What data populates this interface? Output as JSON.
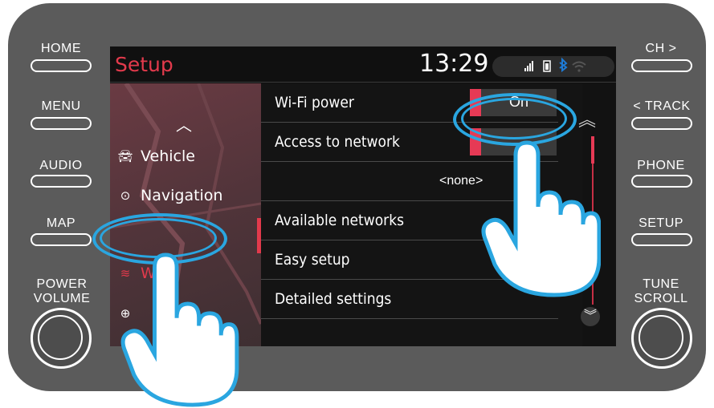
{
  "hardware": {
    "left_buttons": [
      "HOME",
      "MENU",
      "AUDIO",
      "MAP"
    ],
    "right_buttons": [
      "CH >",
      "< TRACK",
      "PHONE",
      "SETUP"
    ],
    "left_knob_label": [
      "POWER",
      "VOLUME"
    ],
    "right_knob_label": [
      "TUNE",
      "SCROLL"
    ]
  },
  "header": {
    "title": "Setup",
    "time": "13:29"
  },
  "sidebar": {
    "items": [
      {
        "label": "Vehicle",
        "icon": "car-icon"
      },
      {
        "label": "Navigation",
        "icon": "navigation-icon"
      },
      {
        "label": "Wi-Fi",
        "icon": "wifi-icon",
        "active": true
      },
      {
        "label": "ne",
        "icon": "globe-icon"
      }
    ]
  },
  "settings": {
    "rows": [
      {
        "label": "Wi-Fi power",
        "toggle": "On"
      },
      {
        "label": "Access to network",
        "toggle": ""
      },
      {
        "label": "",
        "value": "<none>"
      },
      {
        "label": "Available networks"
      },
      {
        "label": "Easy setup"
      },
      {
        "label": "Detailed settings"
      }
    ]
  },
  "colors": {
    "accent": "#e23a4c",
    "highlight": "#2aa6e0",
    "bezel": "#5b5b5b"
  }
}
